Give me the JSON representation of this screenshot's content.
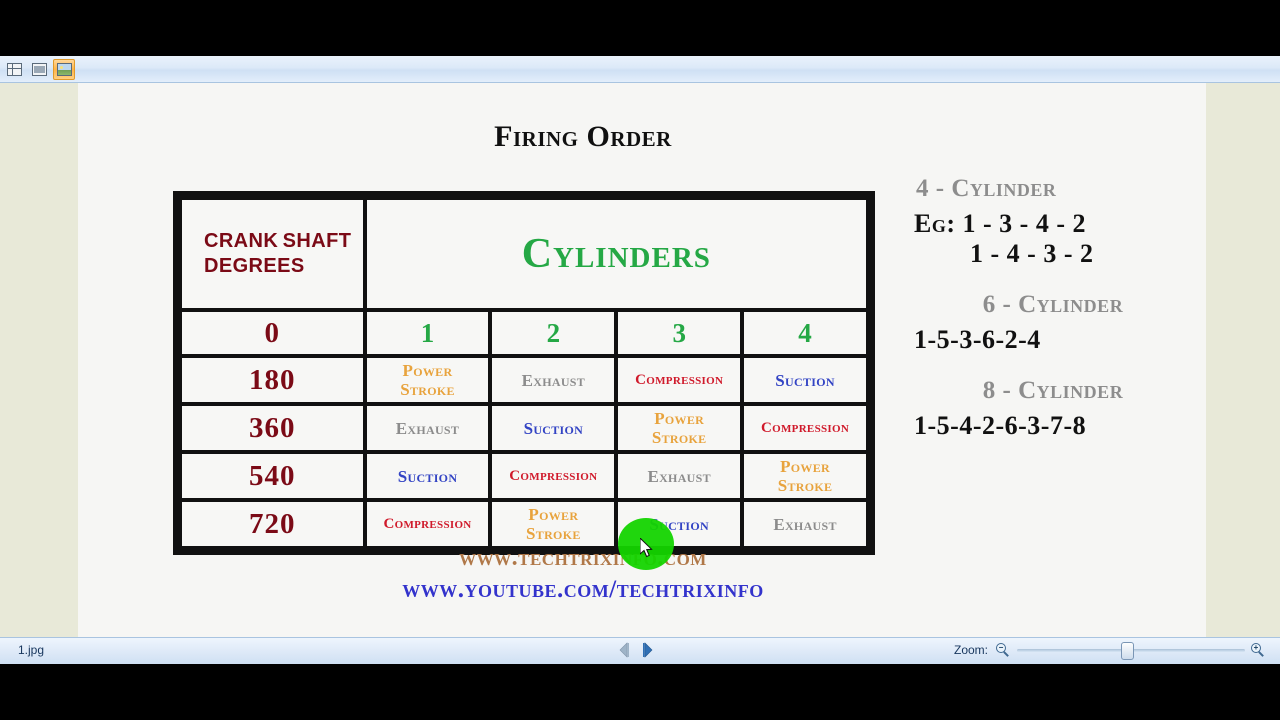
{
  "app": {
    "status_file": "1.jpg",
    "zoom_label": "Zoom:",
    "toolbar": {
      "buttons": [
        {
          "name": "thumbnails-view",
          "icon": "grid-icon",
          "active": false
        },
        {
          "name": "filmstrip-view",
          "icon": "filmstrip-icon",
          "active": false
        },
        {
          "name": "preview-view",
          "icon": "photo-icon",
          "active": true
        }
      ]
    },
    "nav": {
      "previous_label": "Previous",
      "next_label": "Next"
    },
    "zoom_out_label": "Zoom out",
    "zoom_in_label": "Zoom in"
  },
  "slide": {
    "title": "Firing Order",
    "table": {
      "header_left": "CRANK SHAFT DEGREES",
      "header_left_lines": [
        "CRANK",
        "SHAFT",
        "DEGREES"
      ],
      "header_right": "Cylinders",
      "column_labels": [
        "0",
        "1",
        "2",
        "3",
        "4"
      ],
      "rows": [
        {
          "degrees": "180",
          "cells": [
            {
              "label": "Power Stroke",
              "lines": [
                "Power",
                "Stroke"
              ],
              "kind": "power"
            },
            {
              "label": "Exhaust",
              "lines": [
                "Exhaust"
              ],
              "kind": "exhaust"
            },
            {
              "label": "Compression",
              "lines": [
                "Compression"
              ],
              "kind": "compression"
            },
            {
              "label": "Suction",
              "lines": [
                "Suction"
              ],
              "kind": "suction"
            }
          ]
        },
        {
          "degrees": "360",
          "cells": [
            {
              "label": "Exhaust",
              "lines": [
                "Exhaust"
              ],
              "kind": "exhaust"
            },
            {
              "label": "Suction",
              "lines": [
                "Suction"
              ],
              "kind": "suction"
            },
            {
              "label": "Power Stroke",
              "lines": [
                "Power",
                "Stroke"
              ],
              "kind": "power"
            },
            {
              "label": "Compression",
              "lines": [
                "Compression"
              ],
              "kind": "compression"
            }
          ]
        },
        {
          "degrees": "540",
          "cells": [
            {
              "label": "Suction",
              "lines": [
                "Suction"
              ],
              "kind": "suction"
            },
            {
              "label": "Compression",
              "lines": [
                "Compression"
              ],
              "kind": "compression"
            },
            {
              "label": "Exhaust",
              "lines": [
                "Exhaust"
              ],
              "kind": "exhaust"
            },
            {
              "label": "Power Stroke",
              "lines": [
                "Power",
                "Stroke"
              ],
              "kind": "power"
            }
          ]
        },
        {
          "degrees": "720",
          "cells": [
            {
              "label": "Compression",
              "lines": [
                "Compression"
              ],
              "kind": "compression"
            },
            {
              "label": "Power Stroke",
              "lines": [
                "Power",
                "Stroke"
              ],
              "kind": "power"
            },
            {
              "label": "Suction",
              "lines": [
                "Suction"
              ],
              "kind": "suction"
            },
            {
              "label": "Exhaust",
              "lines": [
                "Exhaust"
              ],
              "kind": "exhaust"
            }
          ]
        }
      ]
    },
    "info": [
      {
        "heading": "4 - Cylinder",
        "lines": [
          "Eg: 1 - 3 - 4 - 2",
          "1 - 4 - 3 - 2"
        ]
      },
      {
        "heading": "6 - Cylinder",
        "lines": [
          "1-5-3-6-2-4"
        ]
      },
      {
        "heading": "8 - Cylinder",
        "lines": [
          "1-5-4-2-6-3-7-8"
        ]
      }
    ],
    "urls": {
      "website": "www.techtrixinfo.com",
      "youtube": "www.youtube.com/techtrixinfo"
    }
  },
  "colors": {
    "maroon": "#7b0a16",
    "green": "#25a845",
    "power": "#e8a33d",
    "exhaust": "#8c8c8c",
    "compression": "#d01a2b",
    "suction": "#3344c4",
    "heading_gray": "#8d8d8d",
    "url_brown": "#b07848",
    "url_blue": "#3333cc",
    "cursor_highlight": "#14d400"
  }
}
